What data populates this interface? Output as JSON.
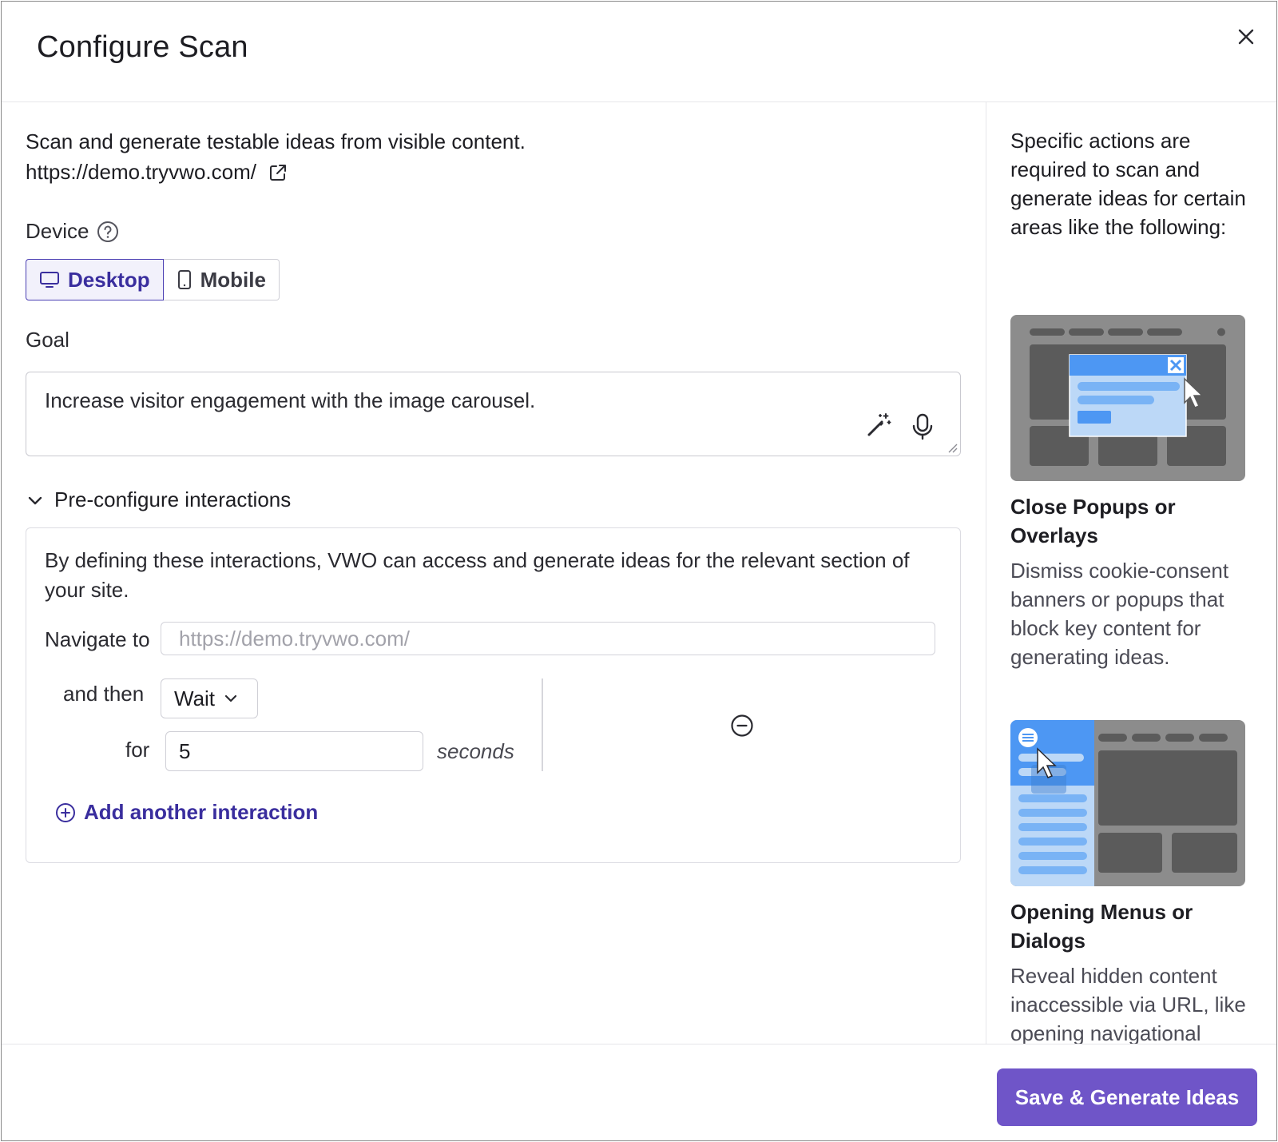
{
  "modal": {
    "title": "Configure Scan",
    "close_icon": "close-icon"
  },
  "main": {
    "intro": "Scan and generate testable ideas from visible content.",
    "url": "https://demo.tryvwo.com/",
    "device": {
      "label": "Device",
      "options": [
        "Desktop",
        "Mobile"
      ],
      "selected": "Desktop"
    },
    "goal": {
      "label": "Goal",
      "value": "Increase visitor engagement with the image carousel."
    },
    "preconfigure": {
      "label": "Pre-configure interactions",
      "description": "By defining these interactions, VWO can access and generate ideas for the relevant section of your site.",
      "navigate_label": "Navigate to",
      "navigate_placeholder": "https://demo.tryvwo.com/",
      "then_label": "and then",
      "action": "Wait",
      "for_label": "for",
      "seconds_value": "5",
      "seconds_label": "seconds",
      "add_label": "Add another interaction"
    }
  },
  "sidebar": {
    "intro": "Specific actions are required to scan and generate ideas for certain areas like the following:",
    "cards": [
      {
        "title": "Close Popups or Overlays",
        "description": "Dismiss cookie-consent banners or popups that block key content for generating ideas."
      },
      {
        "title": "Opening Menus or Dialogs",
        "description": "Reveal hidden content inaccessible via URL, like opening navigational"
      }
    ]
  },
  "footer": {
    "save_label": "Save & Generate Ideas"
  },
  "colors": {
    "accent": "#3a2e9e",
    "primary_button": "#6f55c8"
  }
}
